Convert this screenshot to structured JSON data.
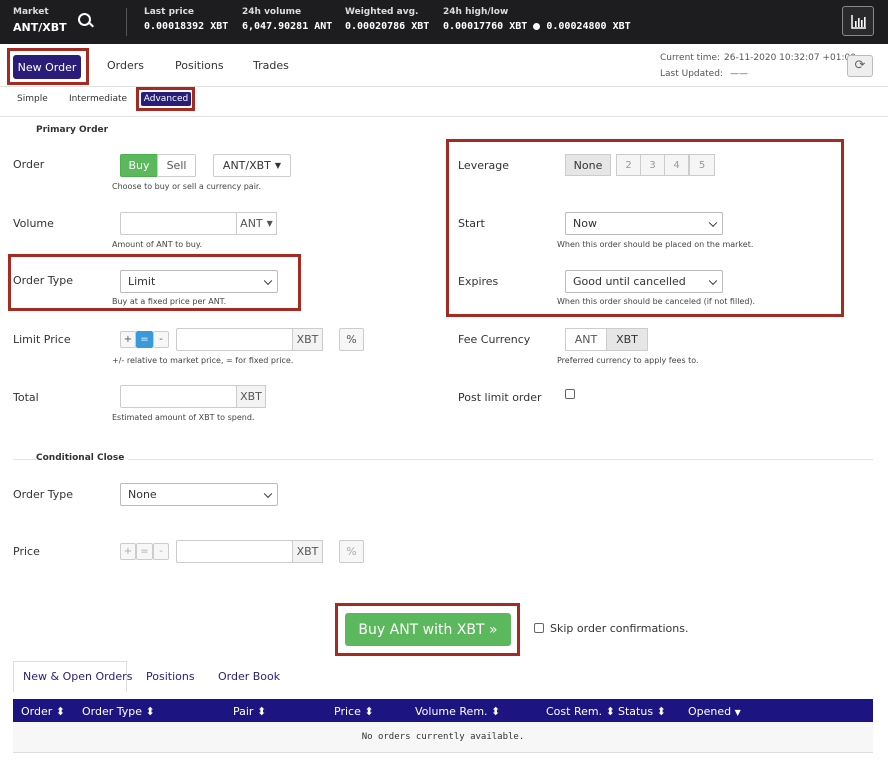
{
  "topbar": {
    "market_label": "Market",
    "market_value": "ANT/XBT",
    "last_price_label": "Last price",
    "last_price_value": "0.00018392 XBT",
    "volume_label": "24h volume",
    "volume_value": "6,047.90281 ANT",
    "wavg_label": "Weighted avg.",
    "wavg_value": "0.00020786 XBT",
    "highlow_label": "24h high/low",
    "high_value": "0.00017760 XBT",
    "low_value": "0.00024800 XBT",
    "icons": [
      "search-icon",
      "bar-chart-icon"
    ]
  },
  "nav": {
    "tabs": [
      "New Order",
      "Orders",
      "Positions",
      "Trades"
    ],
    "current_time_label": "Current time:",
    "current_time_value": "26-11-2020 10:32:07 +01:00",
    "last_updated_label": "Last Updated:",
    "last_updated_value": "——"
  },
  "subtabs": [
    "Simple",
    "Intermediate",
    "Advanced"
  ],
  "primary": {
    "section": "Primary Order",
    "order_label": "Order",
    "buy": "Buy",
    "sell": "Sell",
    "pair": "ANT/XBT",
    "order_hint": "Choose to buy or sell a currency pair.",
    "volume_label": "Volume",
    "volume_unit": "ANT",
    "volume_hint": "Amount of ANT to buy.",
    "order_type_label": "Order Type",
    "order_type_value": "Limit",
    "order_type_hint": "Buy at a fixed price per ANT.",
    "limit_price_label": "Limit Price",
    "plus": "+",
    "equals": "=",
    "minus": "-",
    "limit_unit": "XBT",
    "percent": "%",
    "limit_hint": "+/- relative to market price, = for fixed price.",
    "total_label": "Total",
    "total_unit": "XBT",
    "total_hint": "Estimated amount of XBT to spend."
  },
  "right": {
    "leverage_label": "Leverage",
    "leverage_options": [
      "None",
      "2",
      "3",
      "4",
      "5"
    ],
    "start_label": "Start",
    "start_value": "Now",
    "start_hint": "When this order should be placed on the market.",
    "expires_label": "Expires",
    "expires_value": "Good until cancelled",
    "expires_hint": "When this order should be canceled (if not filled).",
    "fee_label": "Fee Currency",
    "fee_options": [
      "ANT",
      "XBT"
    ],
    "fee_hint": "Preferred currency to apply fees to.",
    "post_limit_label": "Post limit order"
  },
  "conditional": {
    "section": "Conditional Close",
    "order_type_label": "Order Type",
    "order_type_value": "None",
    "price_label": "Price",
    "plus": "+",
    "equals": "=",
    "minus": "-",
    "price_unit": "XBT",
    "percent": "%"
  },
  "submit": {
    "buy_button": "Buy ANT with XBT »",
    "skip_label": "Skip order confirmations."
  },
  "bottom": {
    "tabs": [
      "New & Open Orders",
      "Positions",
      "Order Book"
    ],
    "columns": [
      "Order",
      "Order Type",
      "Pair",
      "Price",
      "Volume Rem.",
      "Cost Rem.",
      "Status",
      "Opened"
    ],
    "empty_text": "No orders currently available."
  },
  "colors": {
    "topbar_bg": "#1d1d1f",
    "accent": "#2a1d7a",
    "buy_green": "#5cb85c",
    "highlight_box": "#a52a22",
    "table_header": "#1c1480"
  }
}
